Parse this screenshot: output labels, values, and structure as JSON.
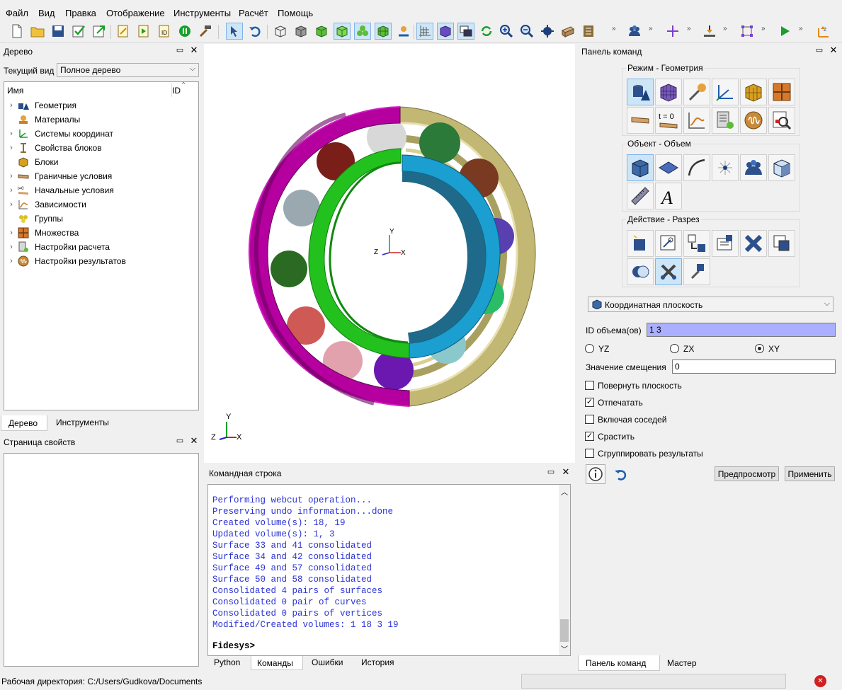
{
  "menu": [
    "Файл",
    "Вид",
    "Правка",
    "Отображение",
    "Инструменты",
    "Расчёт",
    "Помощь"
  ],
  "toolbar": {
    "more": "»",
    "icons": [
      "new-file-icon",
      "open-folder-icon",
      "save-icon",
      "checkmark-icon",
      "export-icon",
      "edit-script-icon",
      "play-script-icon",
      "id-icon",
      "pause-icon",
      "hammer-icon",
      "select-icon",
      "undo-icon",
      "wireframe-cube-icon",
      "hidden-cube-icon",
      "shaded-cube-icon",
      "transparent-cube-icon",
      "color-cube-icon",
      "mesh-cube-icon",
      "person-icon",
      "grid-axes-icon",
      "purple-cube-icon",
      "window-icon",
      "refresh-icon",
      "zoom-in-icon",
      "zoom-out-icon",
      "navigate-icon",
      "box-icon",
      "notes-icon",
      "group-icon",
      "crosshair-icon",
      "tool-icon",
      "node-icon",
      "run-icon",
      "axis-z-icon"
    ]
  },
  "tree_dock": {
    "title": "Дерево",
    "view_label": "Текущий вид",
    "view_value": "Полное дерево",
    "col_name": "Имя",
    "col_id": "ID",
    "items": [
      {
        "label": "Геометрия",
        "icon": "geometry-icon",
        "expandable": true
      },
      {
        "label": "Материалы",
        "icon": "materials-icon",
        "expandable": false
      },
      {
        "label": "Системы координат",
        "icon": "coordinate-system-icon",
        "expandable": true
      },
      {
        "label": "Свойства блоков",
        "icon": "block-properties-icon",
        "expandable": true
      },
      {
        "label": "Блоки",
        "icon": "blocks-icon",
        "expandable": false
      },
      {
        "label": "Граничные условия",
        "icon": "boundary-conditions-icon",
        "expandable": true
      },
      {
        "label": "Начальные условия",
        "icon": "initial-conditions-icon",
        "expandable": true
      },
      {
        "label": "Зависимости",
        "icon": "dependencies-icon",
        "expandable": true
      },
      {
        "label": "Группы",
        "icon": "groups-icon",
        "expandable": false
      },
      {
        "label": "Множества",
        "icon": "sets-icon",
        "expandable": true
      },
      {
        "label": "Настройки расчета",
        "icon": "calc-settings-icon",
        "expandable": true
      },
      {
        "label": "Настройки результатов",
        "icon": "results-settings-icon",
        "expandable": true
      }
    ],
    "tabs": [
      "Дерево",
      "Инструменты"
    ]
  },
  "properties_dock": {
    "title": "Страница свойств"
  },
  "viewport": {
    "axis_y": "Y",
    "axis_x": "X",
    "axis_z": "Z"
  },
  "console": {
    "title": "Командная строка",
    "lines": [
      "Performing webcut operation...",
      "Preserving undo information...done",
      "Created volume(s): 18, 19",
      "Updated volume(s): 1, 3",
      "Surface 33 and 41 consolidated",
      "Surface 34 and 42 consolidated",
      "Surface 49 and 57 consolidated",
      "Surface 50 and 58 consolidated",
      "Consolidated 4 pairs of surfaces",
      "Consolidated 0 pair of curves",
      "Consolidated 0 pairs of vertices",
      "Modified/Created volumes: 1 18 3 19"
    ],
    "prompt": "Fidesys>",
    "tabs": [
      "Python",
      "Команды",
      "Ошибки",
      "История"
    ]
  },
  "command_panel": {
    "title": "Панель команд",
    "group_mode": "Режим - Геометрия",
    "group_object": "Объект - Объем",
    "group_action": "Действие - Разрез",
    "t0_label": "t = 0",
    "dropdown": "Координатная плоскость",
    "volume_id_label": "ID объема(ов)",
    "volume_id_value": "1 3",
    "radio_yz": "YZ",
    "radio_zx": "ZX",
    "radio_xy": "XY",
    "offset_label": "Значение смещения",
    "offset_value": "0",
    "chk_rotate": "Повернуть плоскость",
    "chk_imprint": "Отпечатать",
    "chk_neighbors": "Включая соседей",
    "chk_merge": "Срастить",
    "chk_group": "Сгруппировать результаты",
    "preview_btn": "Предпросмотр",
    "apply_btn": "Применить",
    "tabs": [
      "Панель команд",
      "Мастер"
    ]
  },
  "status": {
    "workdir": "Рабочая директория: C:/Users/Gudkova/Documents"
  },
  "colors": {
    "outer_ring": "#b5009f",
    "outer_ring_back": "#c2b874",
    "inner_ring": "#1a9fd0",
    "cage": "#22c11d",
    "console_text": "#2b33d6"
  }
}
